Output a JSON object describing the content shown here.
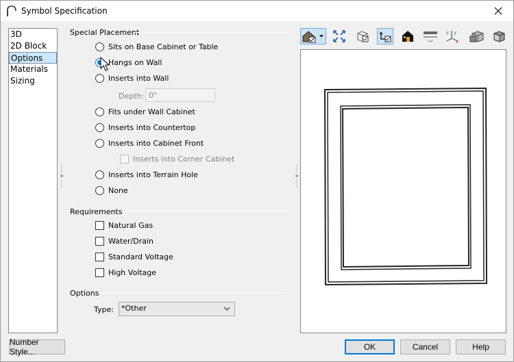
{
  "window": {
    "title": "Symbol Specification",
    "close_icon": "close-icon"
  },
  "nav": {
    "items": [
      {
        "label": "3D",
        "selected": false
      },
      {
        "label": "2D Block",
        "selected": false
      },
      {
        "label": "Options",
        "selected": true
      },
      {
        "label": "Materials",
        "selected": false
      },
      {
        "label": "Sizing",
        "selected": false
      }
    ]
  },
  "special_placement": {
    "heading": "Special Placement",
    "options": [
      {
        "label": "Sits on Base Cabinet or Table",
        "checked": false
      },
      {
        "label": "Hangs on Wall",
        "checked": true
      },
      {
        "label": "Inserts into Wall",
        "checked": false
      },
      {
        "label": "Fits under Wall Cabinet",
        "checked": false
      },
      {
        "label": "Inserts into Countertop",
        "checked": false
      },
      {
        "label": "Inserts into Cabinet Front",
        "checked": false
      },
      {
        "label": "Inserts into Terrain Hole",
        "checked": false
      },
      {
        "label": "None",
        "checked": false
      }
    ],
    "depth_label": "Depth:",
    "depth_value": "0\"",
    "corner_cabinet_label": "Inserts into Corner Cabinet",
    "corner_cabinet_checked": false
  },
  "requirements": {
    "heading": "Requirements",
    "items": [
      {
        "label": "Natural Gas",
        "checked": false
      },
      {
        "label": "Water/Drain",
        "checked": false
      },
      {
        "label": "Standard Voltage",
        "checked": false
      },
      {
        "label": "High Voltage",
        "checked": false
      }
    ]
  },
  "options": {
    "heading": "Options",
    "type_label": "Type:",
    "type_value": "*Other"
  },
  "toolbar": {
    "icons": [
      "view-type-icon",
      "fit-view-icon",
      "wireframe-icon",
      "rotate-view-icon",
      "house-color-icon",
      "render-mode-icon",
      "axes-icon",
      "shaded-cube-icon",
      "solid-cube-icon"
    ]
  },
  "buttons": {
    "number_style": "Number Style...",
    "ok": "OK",
    "cancel": "Cancel",
    "help": "Help"
  },
  "colors": {
    "accent": "#0078d7",
    "selection": "#cce8ff"
  }
}
